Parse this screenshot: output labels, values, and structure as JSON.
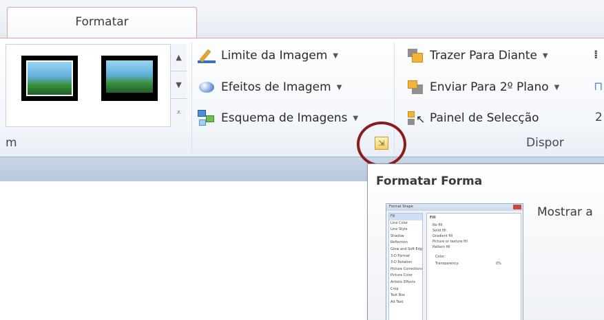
{
  "tab": {
    "label": "Formatar"
  },
  "image_styles_group": {
    "label_partial": "m"
  },
  "image_commands": [
    {
      "label": "Limite da Imagem",
      "icon": "picture-border-icon"
    },
    {
      "label": "Efeitos de Imagem",
      "icon": "picture-effects-icon"
    },
    {
      "label": "Esquema de Imagens",
      "icon": "picture-layout-icon"
    }
  ],
  "arrange_group": {
    "label": "Dispor",
    "commands": [
      {
        "label": "Trazer Para Diante",
        "icon": "bring-forward-icon"
      },
      {
        "label": "Enviar Para 2º Plano",
        "icon": "send-backward-icon"
      },
      {
        "label": "Painel de Selecção",
        "icon": "selection-pane-icon"
      }
    ],
    "partial_digit": "2"
  },
  "launcher": {
    "icon": "dialog-launcher-icon"
  },
  "tooltip": {
    "title": "Formatar Forma",
    "description": "Mostrar a",
    "preview": {
      "title": "Format Shape",
      "list": [
        "Fill",
        "Line Color",
        "Line Style",
        "Shadow",
        "Reflection",
        "Glow and Soft Edges",
        "3-D Format",
        "3-D Rotation",
        "Picture Corrections",
        "Picture Color",
        "Artistic Effects",
        "Crop",
        "Text Box",
        "Alt Text"
      ],
      "pane_heading": "Fill",
      "pane_options": [
        "No fill",
        "Solid fill",
        "Gradient fill",
        "Picture or texture fill",
        "Pattern fill"
      ],
      "color_label": "Color:",
      "transparency_label": "Transparency:",
      "transparency_value": "0%"
    }
  },
  "colors": {
    "accent_tab_border": "#e39cb2",
    "highlight_circle": "#8b1c1c"
  }
}
